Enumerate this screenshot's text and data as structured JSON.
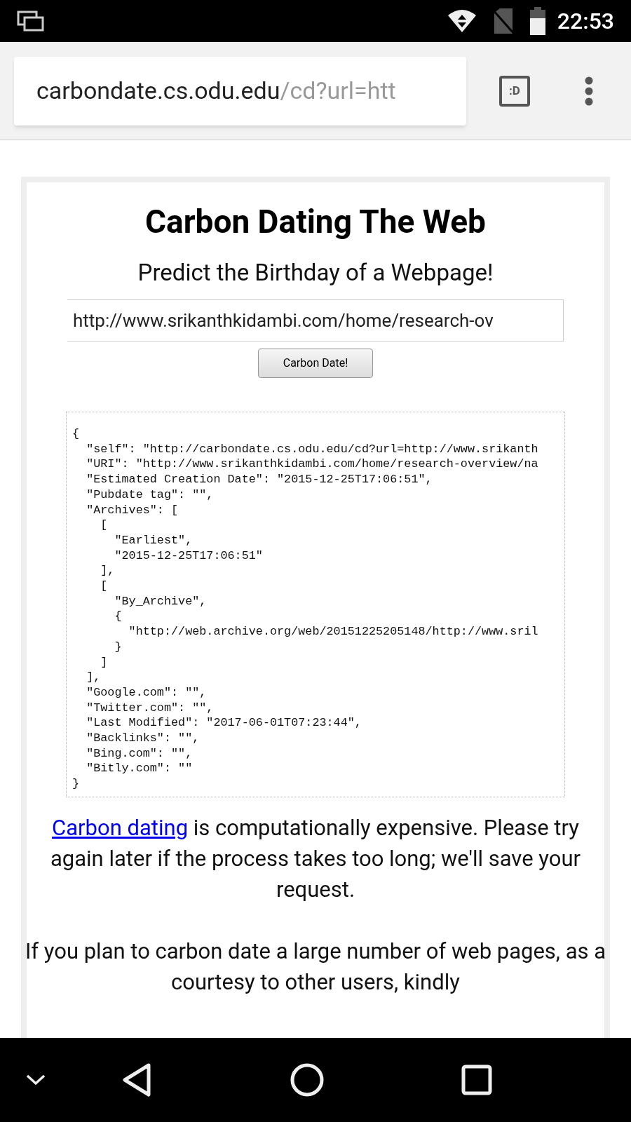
{
  "status_bar": {
    "time": "22:53"
  },
  "toolbar": {
    "url_host": "carbondate.cs.odu.edu",
    "url_path": "/cd?url=htt",
    "tab_button": ":D"
  },
  "page": {
    "title": "Carbon Dating The Web",
    "subtitle": "Predict the Birthday of a Webpage!",
    "url_input": {
      "value": "http://www.srikanthkidambi.com/home/research-ov"
    },
    "submit_button": "Carbon Date!",
    "result_lines": [
      "{",
      "  \"self\": \"http://carbondate.cs.odu.edu/cd?url=http://www.srikanth",
      "  \"URI\": \"http://www.srikanthkidambi.com/home/research-overview/na",
      "  \"Estimated Creation Date\": \"2015-12-25T17:06:51\",",
      "  \"Pubdate tag\": \"\",",
      "  \"Archives\": [",
      "    [",
      "      \"Earliest\",",
      "      \"2015-12-25T17:06:51\"",
      "    ],",
      "    [",
      "      \"By_Archive\",",
      "      {",
      "        \"http://web.archive.org/web/20151225205148/http://www.sril",
      "      }",
      "    ]",
      "  ],",
      "  \"Google.com\": \"\",",
      "  \"Twitter.com\": \"\",",
      "  \"Last Modified\": \"2017-06-01T07:23:44\",",
      "  \"Backlinks\": \"\",",
      "  \"Bing.com\": \"\",",
      "  \"Bitly.com\": \"\"",
      "}"
    ],
    "notice": {
      "link": "Carbon dating",
      "text": " is computationally expensive. Please try again later if the process takes too long; we'll save your request."
    },
    "courtesy": "If you plan to carbon date a large number of web pages, as a courtesy to other users, kindly"
  }
}
